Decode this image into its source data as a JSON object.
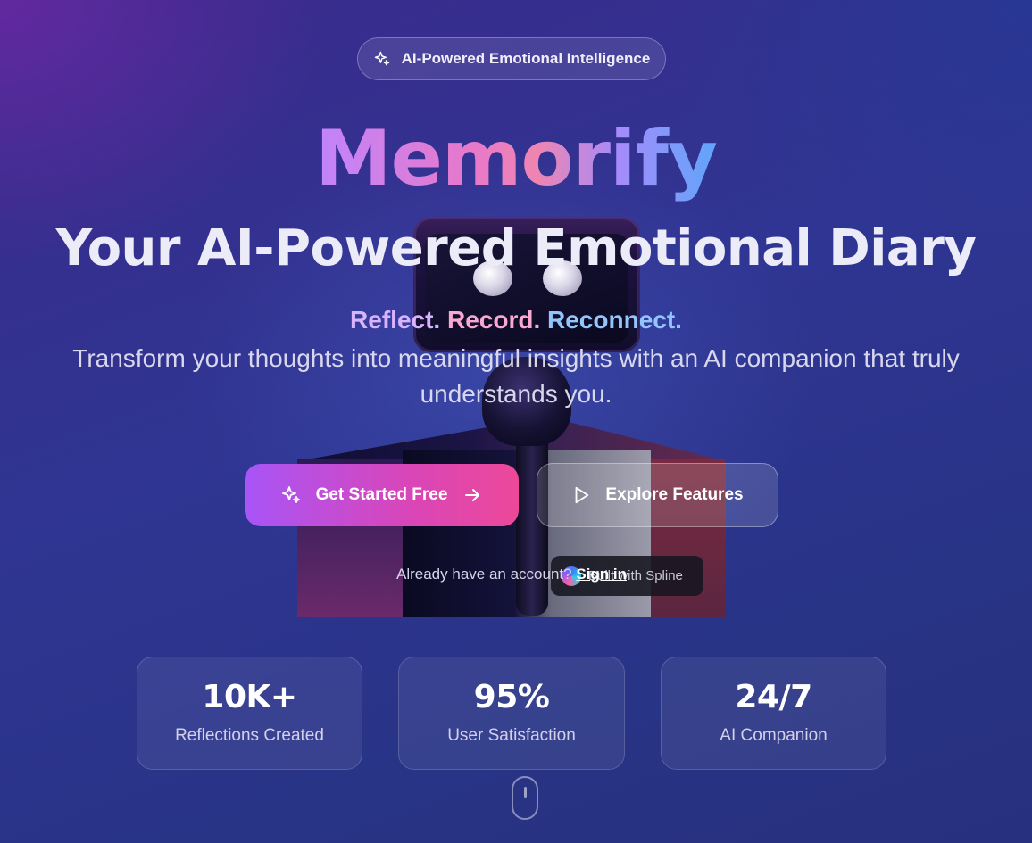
{
  "badge": {
    "icon": "sparkles-icon",
    "label": "AI-Powered Emotional Intelligence"
  },
  "hero": {
    "brand": "Memorify",
    "headline": "Your AI-Powered Emotional Diary",
    "tagline": {
      "part1": "Reflect.",
      "part2": "Record.",
      "part3": "Reconnect."
    },
    "description": "Transform your thoughts into meaningful insights with an AI companion that truly understands you."
  },
  "cta": {
    "primary_label": "Get Started Free",
    "primary_icon": "sparkles-icon",
    "primary_trailing_icon": "arrow-right-icon",
    "secondary_label": "Explore Features",
    "secondary_icon": "play-icon"
  },
  "auth": {
    "prompt": "Already have an account?",
    "link": "Sign in"
  },
  "spline_badge": {
    "label": "Built with Spline"
  },
  "stats": [
    {
      "value": "10K+",
      "label": "Reflections Created"
    },
    {
      "value": "95%",
      "label": "User Satisfaction"
    },
    {
      "value": "24/7",
      "label": "AI Companion"
    }
  ],
  "colors": {
    "brand_gradient": [
      "#c084fc",
      "#e879c9",
      "#60a5fa"
    ],
    "primary_button": [
      "#a855f7",
      "#ec4899"
    ],
    "background": "#2f3592"
  }
}
